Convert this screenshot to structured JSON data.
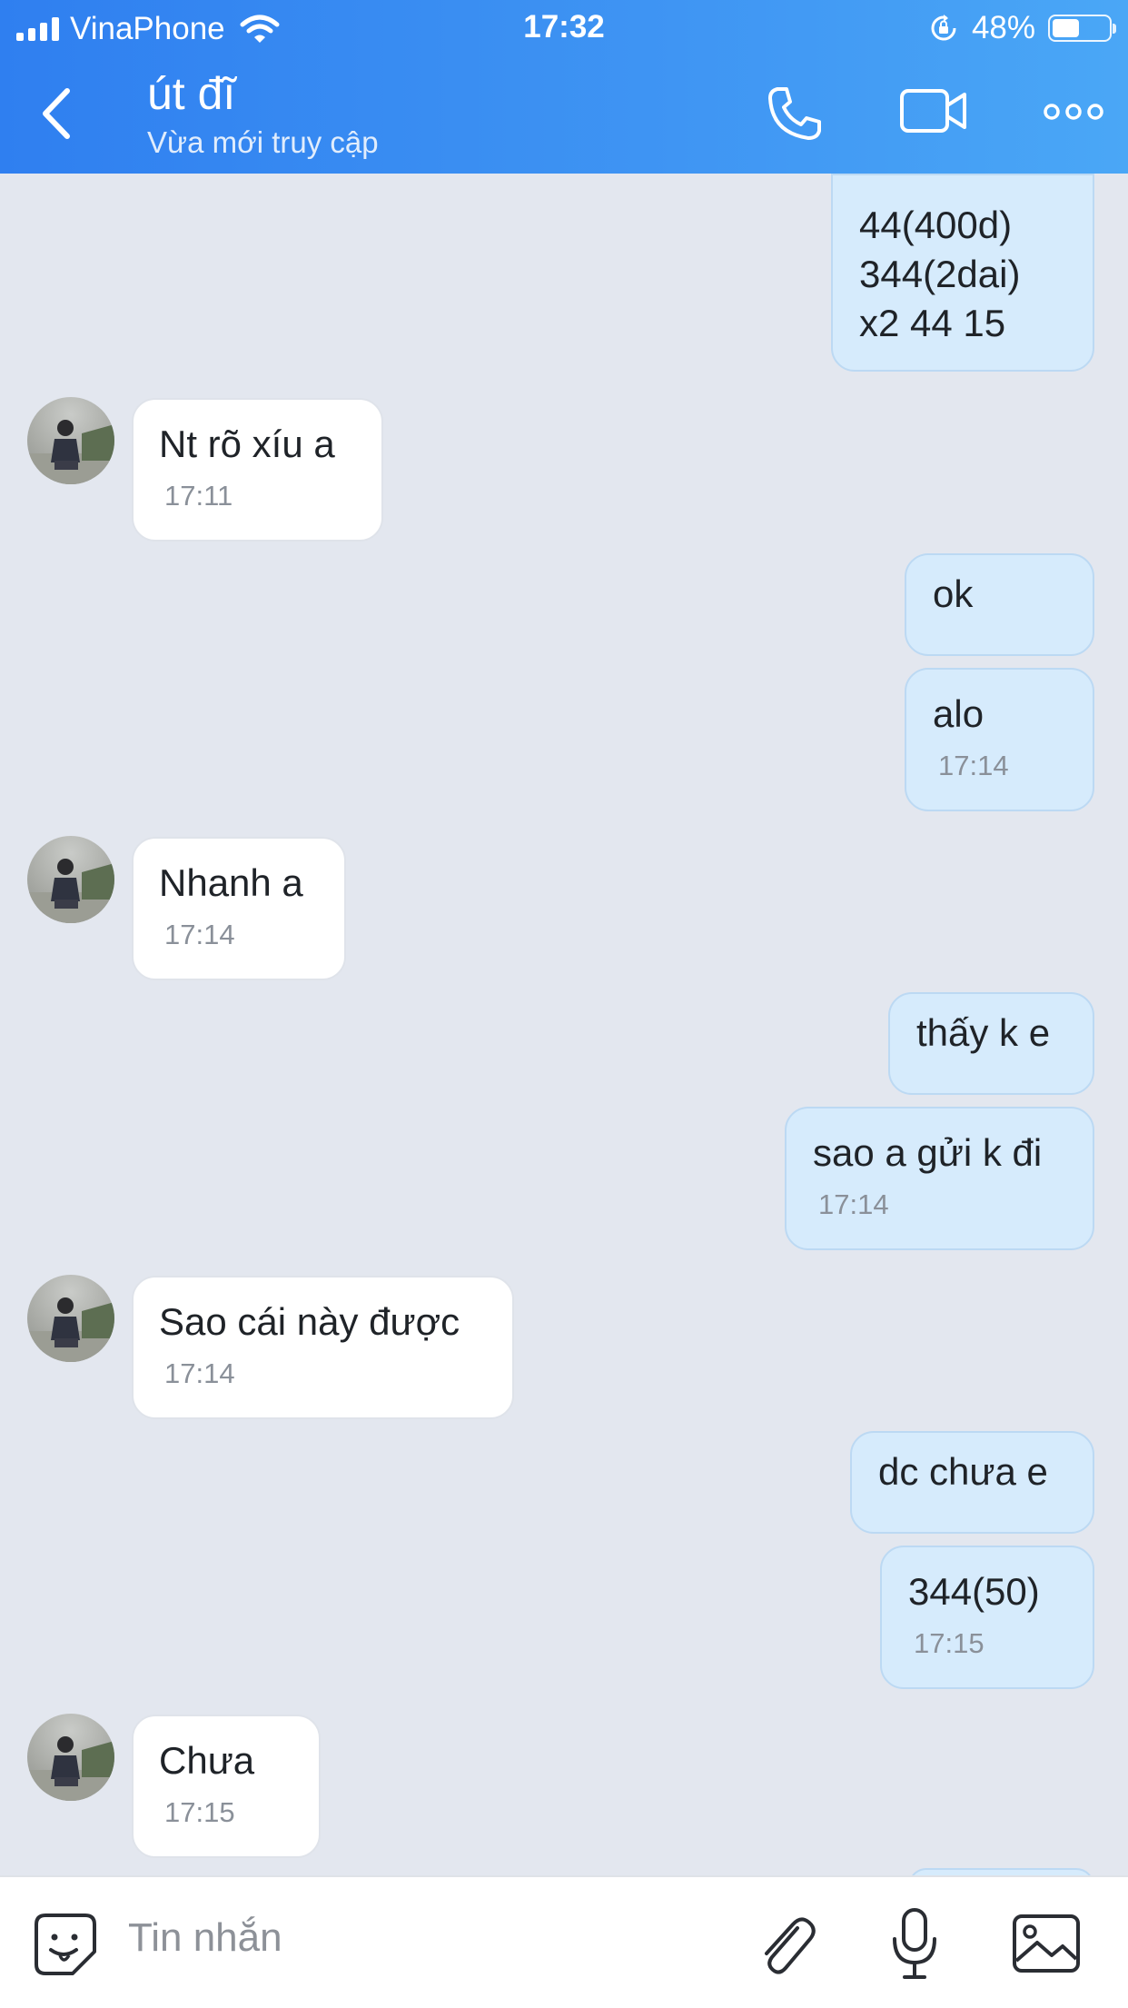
{
  "status_bar": {
    "carrier": "VinaPhone",
    "time": "17:32",
    "battery_percent": "48%",
    "battery_level": 0.48
  },
  "header": {
    "contact_name": "út đĩ",
    "contact_status": "Vừa mới truy cập",
    "icons": [
      "back-icon",
      "phone-icon",
      "video-icon",
      "more-icon"
    ],
    "color": "#3a8ef2"
  },
  "messages": [
    {
      "dir": "out",
      "text": "44(400d)\n344(2dai)\nx2 44 15",
      "time": ""
    },
    {
      "dir": "in",
      "text": "Nt rõ xíu a",
      "time": "17:11"
    },
    {
      "dir": "out",
      "text": "ok",
      "time": ""
    },
    {
      "dir": "out",
      "text": "alo",
      "time": "17:14"
    },
    {
      "dir": "in",
      "text": "Nhanh a",
      "time": "17:14"
    },
    {
      "dir": "out",
      "text": "thấy k e",
      "time": ""
    },
    {
      "dir": "out",
      "text": "sao a gửi k đi",
      "time": "17:14"
    },
    {
      "dir": "in",
      "text": "Sao cái này được",
      "time": "17:14"
    },
    {
      "dir": "out",
      "text": "dc chưa e",
      "time": ""
    },
    {
      "dir": "out",
      "text": "344(50)",
      "time": "17:15"
    },
    {
      "dir": "in",
      "text": "Chưa",
      "time": "17:15"
    }
  ],
  "composer": {
    "placeholder": "Tin nhắn",
    "icons": [
      "sticker-icon",
      "attach-icon",
      "mic-icon",
      "image-icon"
    ]
  },
  "colors": {
    "outgoing_bubble": "#d6ebfc",
    "incoming_bubble": "#ffffff",
    "chat_background": "#e3e7ef"
  }
}
